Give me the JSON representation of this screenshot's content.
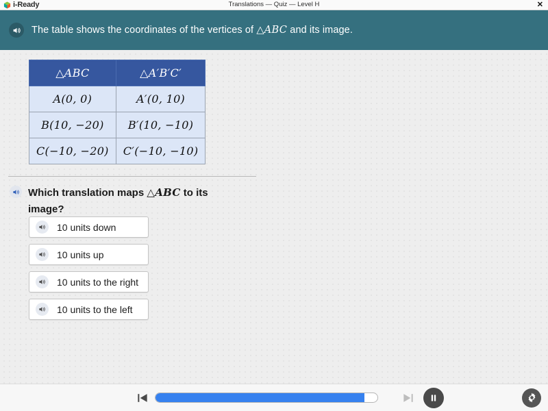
{
  "titlebar": {
    "logo_text": "i-Ready",
    "logo_icon": "cube-icon",
    "window_title": "Translations — Quiz — Level H",
    "close_label": "✕"
  },
  "banner": {
    "speaker_icon": "speaker-icon",
    "text_before": "The table shows the coordinates of the vertices of ",
    "math": "△ABC",
    "text_after": " and its image."
  },
  "table": {
    "headers": [
      "△ABC",
      "△A′B′C′"
    ],
    "rows": [
      [
        "A(0, 0)",
        "A′(0, 10)"
      ],
      [
        "B(10, −20)",
        "B′(10, −10)"
      ],
      [
        "C(−10, −20)",
        "C′(−10, −10)"
      ]
    ]
  },
  "question": {
    "speaker_icon": "speaker-icon",
    "text_before": "Which translation maps ",
    "math": "△ABC",
    "text_after": " to its image?"
  },
  "options": [
    {
      "label": "10 units down",
      "speaker_icon": "speaker-icon"
    },
    {
      "label": "10 units up",
      "speaker_icon": "speaker-icon"
    },
    {
      "label": "10 units to the right",
      "speaker_icon": "speaker-icon"
    },
    {
      "label": "10 units to the left",
      "speaker_icon": "speaker-icon"
    }
  ],
  "toolbar": {
    "prev_icon": "skip-back-icon",
    "next_icon": "skip-forward-icon",
    "pause_icon": "pause-icon",
    "settings_icon": "gear-icon",
    "progress_percent": 94
  },
  "colors": {
    "banner_teal": "#35707f",
    "table_header_blue": "#36579f",
    "table_cell_blue": "#dce6f7",
    "progress_blue": "#3681ef",
    "canvas_gray": "#eeeeee"
  }
}
